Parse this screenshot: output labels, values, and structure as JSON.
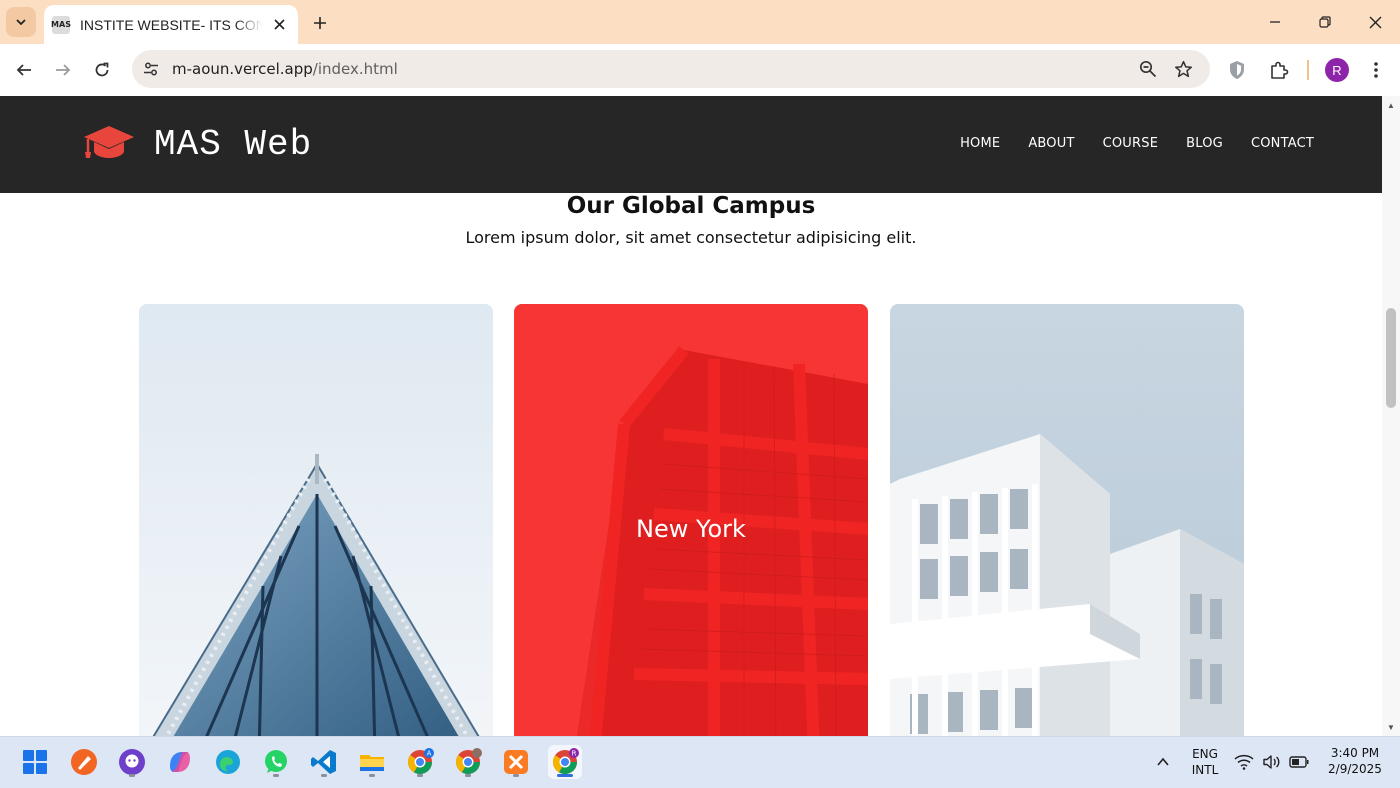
{
  "browser": {
    "tab": {
      "favicon_text": "MAS",
      "title": "INSTITE WEBSITE- ITS CONTENT"
    },
    "address": {
      "domain": "m-aoun.vercel.app",
      "path": "/index.html"
    },
    "profile_initial": "R"
  },
  "site": {
    "logo_text": "MAS Web",
    "nav": [
      "HOME",
      "ABOUT",
      "COURSE",
      "BLOG",
      "CONTACT"
    ],
    "section": {
      "title": "Our Global Campus",
      "subtitle": "Lorem ipsum dolor, sit amet consectetur adipisicing elit."
    },
    "cards": [
      {
        "label": ""
      },
      {
        "label": "New York"
      },
      {
        "label": ""
      }
    ],
    "colors": {
      "header_bg": "#262626",
      "logo_accent": "#e8453c",
      "card_overlay": "#ff2828"
    }
  },
  "taskbar": {
    "apps": [
      "start-icon",
      "brush-app-icon",
      "github-desktop-icon",
      "copilot-icon",
      "edge-icon",
      "whatsapp-icon",
      "vscode-icon",
      "file-explorer-icon",
      "chrome-profile-a-icon",
      "chrome-profile-2-icon",
      "xampp-icon",
      "chrome-profile-r-icon"
    ],
    "badges": {
      "chrome_a": "A",
      "chrome_r": "R"
    },
    "language": {
      "line1": "ENG",
      "line2": "INTL"
    },
    "time": "3:40 PM",
    "date": "2/9/2025"
  }
}
